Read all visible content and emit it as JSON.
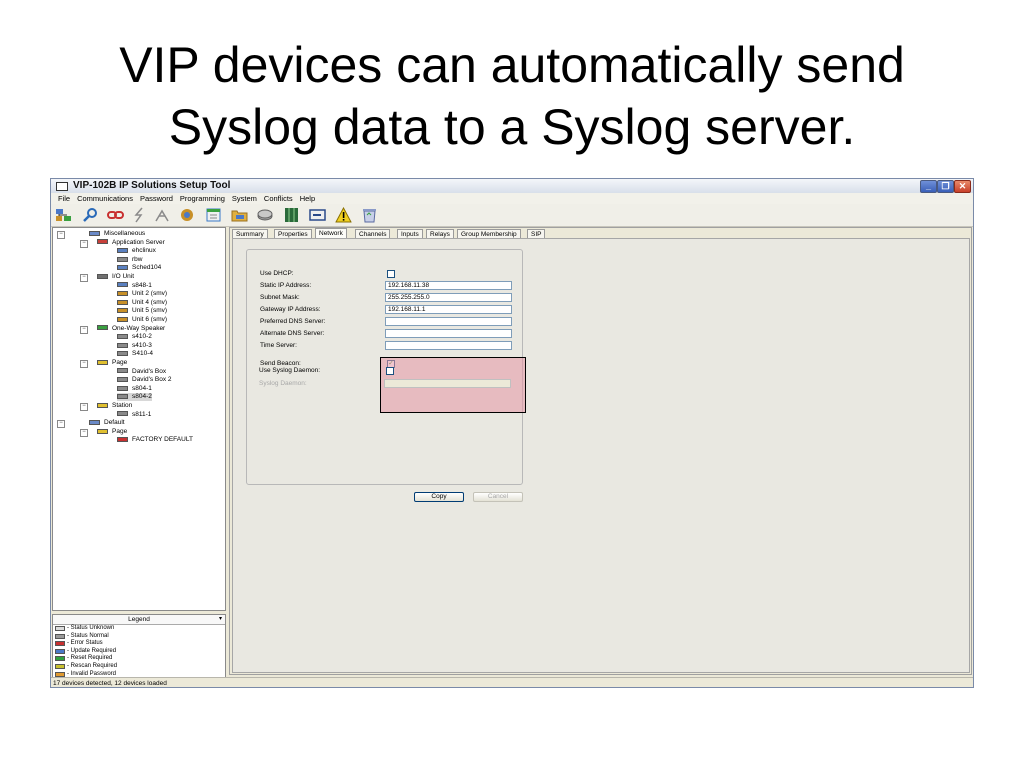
{
  "slide": {
    "title_line1": "VIP devices can automatically send",
    "title_line2": "Syslog data to a Syslog server."
  },
  "window": {
    "title": "VIP-102B IP Solutions Setup Tool",
    "minimize": "_",
    "maximize": "❐",
    "close": "✕"
  },
  "menu": [
    "File",
    "Communications",
    "Password",
    "Programming",
    "System",
    "Conflicts",
    "Help"
  ],
  "toolbar_icons": [
    "network-tree-icon",
    "search-icon",
    "link-icon",
    "lightning-icon",
    "antenna-icon",
    "settings-icon",
    "calendar-icon",
    "folder-icon",
    "disk-icon",
    "grid-icon",
    "device-icon",
    "warning-icon",
    "recycle-bin-icon"
  ],
  "tree": [
    {
      "label": "Miscellaneous",
      "level": 0,
      "expander": "−",
      "icon": "#6a8ac8"
    },
    {
      "label": "Application Server",
      "level": 1,
      "expander": "−",
      "icon": "#c8403a"
    },
    {
      "label": "ehclinux",
      "level": 2,
      "icon": "#5a80c0"
    },
    {
      "label": "rbw",
      "level": 2,
      "icon": "#8a8a8a"
    },
    {
      "label": "Sched104",
      "level": 2,
      "icon": "#5a80c0"
    },
    {
      "label": "I/O Unit",
      "level": 1,
      "expander": "−",
      "icon": "#707070"
    },
    {
      "label": "s848-1",
      "level": 2,
      "icon": "#5a80c0"
    },
    {
      "label": "Unit 2 (smv)",
      "level": 2,
      "icon": "#c89028"
    },
    {
      "label": "Unit 4 (smv)",
      "level": 2,
      "icon": "#c89028"
    },
    {
      "label": "Unit 5 (smv)",
      "level": 2,
      "icon": "#c89028"
    },
    {
      "label": "Unit 6 (smv)",
      "level": 2,
      "icon": "#c89028"
    },
    {
      "label": "One-Way Speaker",
      "level": 1,
      "expander": "−",
      "icon": "#3aa040"
    },
    {
      "label": "s410-2",
      "level": 2,
      "icon": "#8a8a8a"
    },
    {
      "label": "s410-3",
      "level": 2,
      "icon": "#8a8a8a"
    },
    {
      "label": "S410-4",
      "level": 2,
      "icon": "#8a8a8a"
    },
    {
      "label": "Page",
      "level": 1,
      "expander": "−",
      "icon": "#e0c030"
    },
    {
      "label": "David's Box",
      "level": 2,
      "icon": "#8a8a8a"
    },
    {
      "label": "David's Box 2",
      "level": 2,
      "icon": "#8a8a8a"
    },
    {
      "label": "s804-1",
      "level": 2,
      "icon": "#8a8a8a"
    },
    {
      "label": "s804-2",
      "level": 2,
      "icon": "#8a8a8a",
      "selected": true
    },
    {
      "label": "Station",
      "level": 1,
      "expander": "−",
      "icon": "#e0c030"
    },
    {
      "label": "s811-1",
      "level": 2,
      "icon": "#8a8a8a"
    },
    {
      "label": "Default",
      "level": 0,
      "expander": "−",
      "icon": "#6a8ac8"
    },
    {
      "label": "Page",
      "level": 1,
      "expander": "−",
      "icon": "#e0c030"
    },
    {
      "label": "FACTORY DEFAULT",
      "level": 2,
      "icon": "#c83030"
    }
  ],
  "legend": {
    "title": "Legend",
    "arrow": "▾",
    "items": [
      {
        "label": "- Status Unknown",
        "color": "#dcdcdc"
      },
      {
        "label": "- Status Normal",
        "color": "#9a9a9a"
      },
      {
        "label": "- Error Status",
        "color": "#c83030"
      },
      {
        "label": "- Update Required",
        "color": "#4a78c8"
      },
      {
        "label": "- Reset Required",
        "color": "#30a040"
      },
      {
        "label": "- Rescan Required",
        "color": "#c8c030"
      },
      {
        "label": "- Invalid Password",
        "color": "#e09a30"
      }
    ]
  },
  "tabs": [
    "Summary",
    "Properties",
    "Network",
    "Channels",
    "Inputs",
    "Relays",
    "Group Membership",
    "SIP"
  ],
  "active_tab": "Network",
  "network": {
    "use_dhcp_label": "Use DHCP:",
    "use_dhcp_checked": false,
    "static_ip_label": "Static IP Address:",
    "static_ip_value": "192.168.11.38",
    "subnet_label": "Subnet Mask:",
    "subnet_value": "255.255.255.0",
    "gateway_label": "Gateway IP Address:",
    "gateway_value": "192.168.11.1",
    "preferred_dns_label": "Preferred DNS Server:",
    "preferred_dns_value": "",
    "alternate_dns_label": "Alternate DNS Server:",
    "alternate_dns_value": "",
    "time_server_label": "Time Server:",
    "time_server_value": "",
    "send_beacon_label": "Send Beacon:",
    "send_beacon_checked": true,
    "send_beacon_mark": "✓",
    "use_syslog_label": "Use Syslog Daemon:",
    "use_syslog_checked": false,
    "syslog_daemon_label": "Syslog Daemon:",
    "syslog_daemon_value": ""
  },
  "buttons": {
    "copy": "Copy",
    "cancel": "Cancel"
  },
  "status": {
    "text": "17 devices detected, 12 devices loaded"
  },
  "colors": {
    "highlight": "#e696a5",
    "xp_blue": "#3a5fb8",
    "panel_bg": "#ece9d8"
  }
}
